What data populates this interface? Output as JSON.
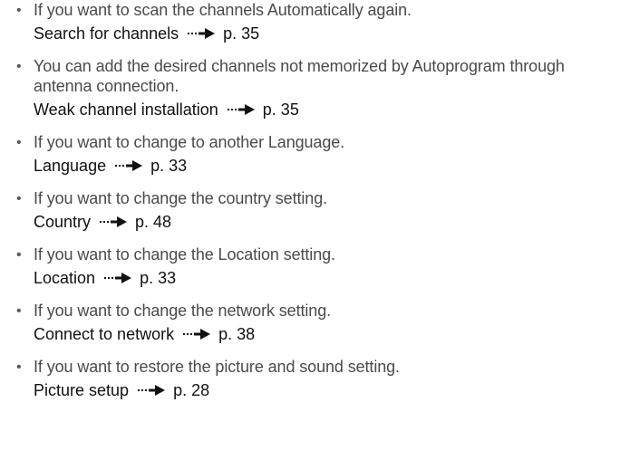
{
  "items": [
    {
      "description": "If you want to scan the channels Automatically again.",
      "ref_label": "Search for channels",
      "ref_page": "p. 35"
    },
    {
      "description": "You can add the desired channels not memorized by Autoprogram through antenna connection.",
      "ref_label": "Weak channel installation",
      "ref_page": "p. 35"
    },
    {
      "description": "If you want to change to another Language.",
      "ref_label": "Language",
      "ref_page": "p. 33"
    },
    {
      "description": "If you want to change the country setting.",
      "ref_label": "Country",
      "ref_page": "p. 48"
    },
    {
      "description": "If you want to change the Location setting.",
      "ref_label": "Location",
      "ref_page": "p. 33"
    },
    {
      "description": "If you want to change the network setting.",
      "ref_label": "Connect to network",
      "ref_page": "p. 38"
    },
    {
      "description": "If you want to restore the picture and sound setting.",
      "ref_label": "Picture setup",
      "ref_page": "p. 28"
    }
  ],
  "icons": {
    "bullet": "bullet-dot",
    "arrow": "right-arrow-icon"
  }
}
